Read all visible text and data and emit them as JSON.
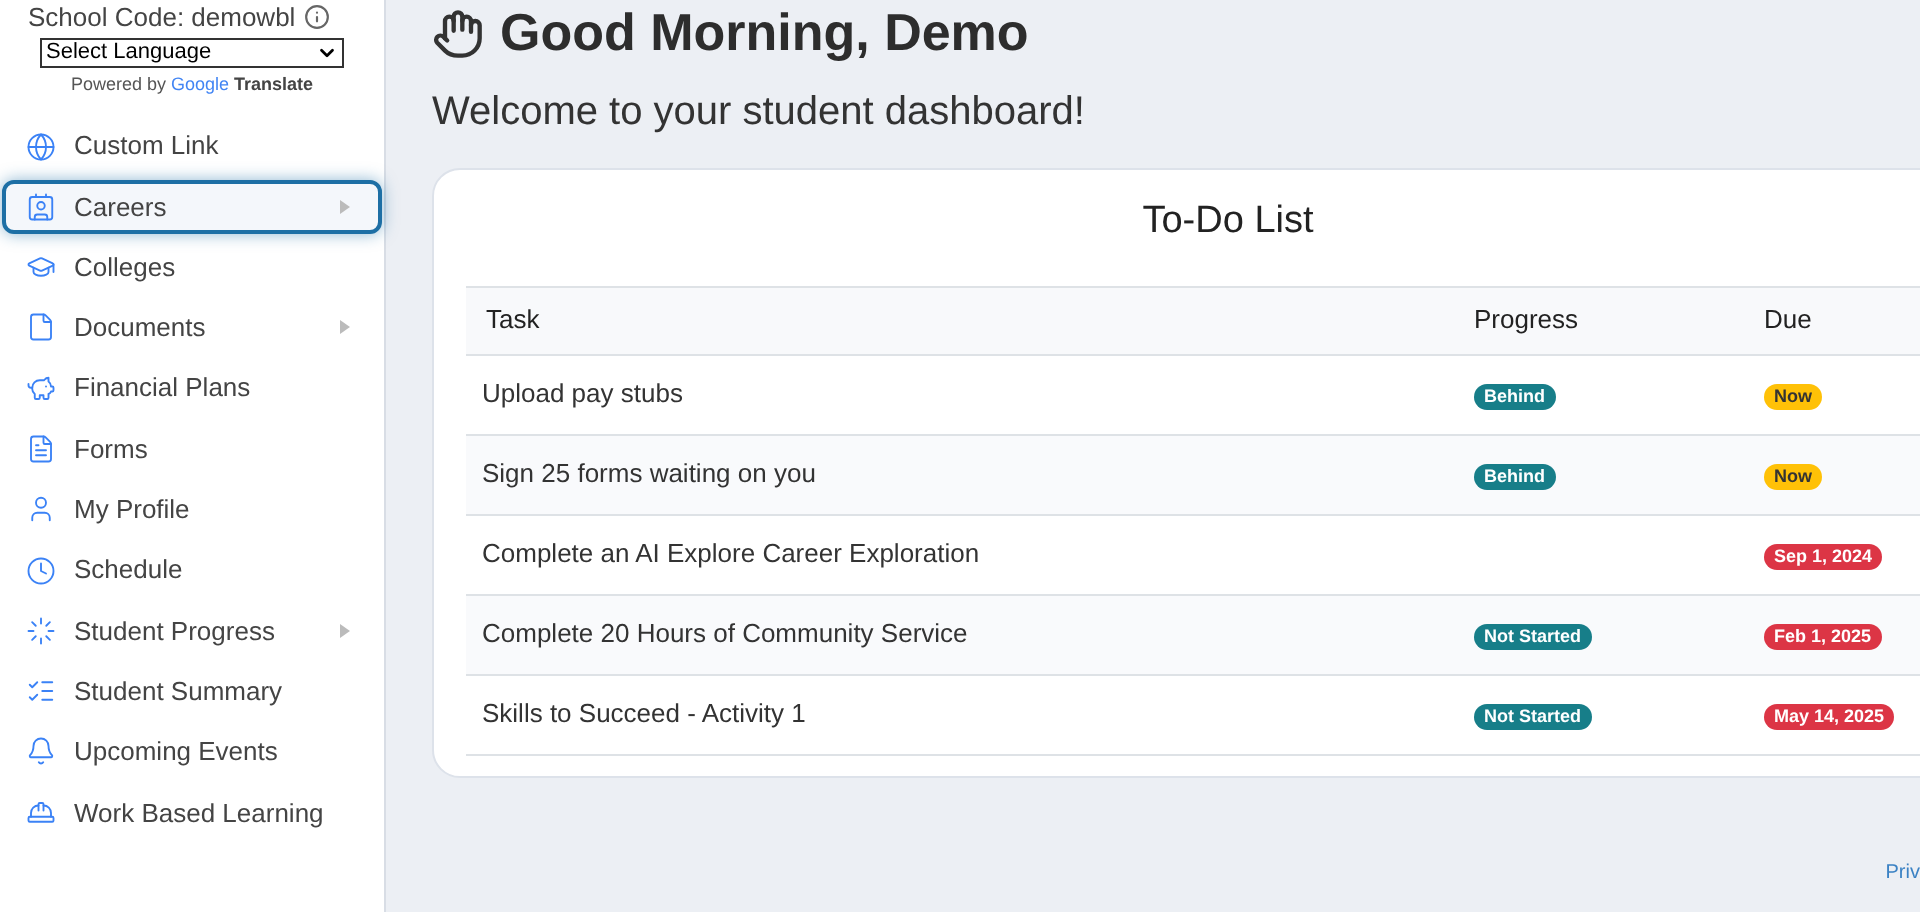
{
  "sidebar": {
    "school_code": "School Code: demowbl",
    "language_select": {
      "value": "Select Language"
    },
    "powered_by": {
      "prefix": "Powered by",
      "brand": "Google",
      "suffix": "Translate"
    },
    "items": [
      {
        "label": "Custom Link",
        "kind": "globe",
        "selected": false,
        "has_submenu": false
      },
      {
        "label": "Careers",
        "kind": "career",
        "selected": true,
        "has_submenu": true
      },
      {
        "label": "Colleges",
        "kind": "cap",
        "selected": false,
        "has_submenu": false
      },
      {
        "label": "Documents",
        "kind": "file",
        "selected": false,
        "has_submenu": true
      },
      {
        "label": "Financial Plans",
        "kind": "piggy",
        "selected": false,
        "has_submenu": false
      },
      {
        "label": "Forms",
        "kind": "form",
        "selected": false,
        "has_submenu": false
      },
      {
        "label": "My Profile",
        "kind": "user",
        "selected": false,
        "has_submenu": false
      },
      {
        "label": "Schedule",
        "kind": "clock",
        "selected": false,
        "has_submenu": false
      },
      {
        "label": "Student Progress",
        "kind": "progress",
        "selected": false,
        "has_submenu": true
      },
      {
        "label": "Student Summary",
        "kind": "list",
        "selected": false,
        "has_submenu": false
      },
      {
        "label": "Upcoming Events",
        "kind": "bell",
        "selected": false,
        "has_submenu": false
      },
      {
        "label": "Work Based Learning",
        "kind": "worker",
        "selected": false,
        "has_submenu": false
      }
    ]
  },
  "greeting": "Good Morning, Demo",
  "subtitle": "Welcome to your student dashboard!",
  "todo": {
    "title": "To-Do List",
    "columns": [
      "Task",
      "Progress",
      "Due"
    ],
    "rows": [
      {
        "task": "Upload pay stubs",
        "progress": "Behind",
        "due": {
          "label": "Now",
          "color": "#ffc107"
        }
      },
      {
        "task": "Sign 25 forms waiting on you",
        "progress": "Behind",
        "due": {
          "label": "Now",
          "color": "#ffc107"
        }
      },
      {
        "task": "Complete an AI Explore Career Exploration",
        "due": {
          "label": "Sep 1, 2024",
          "color": "#dc3545"
        }
      },
      {
        "task": "Complete 20 Hours of Community Service",
        "progress": "Not Started",
        "due": {
          "label": "Feb 1, 2025",
          "color": "#dc3545"
        }
      },
      {
        "task": "Skills to Succeed - Activity 1",
        "progress": "Not Started",
        "due": {
          "label": "May 14, 2025",
          "color": "#dc3545"
        }
      }
    ]
  },
  "footer_link": "Priv"
}
